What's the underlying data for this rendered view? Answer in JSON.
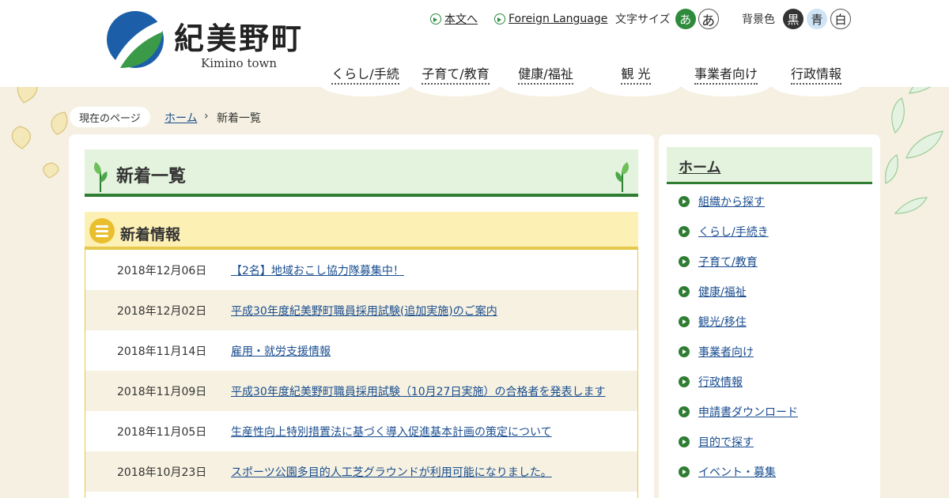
{
  "site": {
    "title": "紀美野町",
    "subtitle": "Kimino town"
  },
  "util": {
    "skip_label": "本文へ",
    "foreign_label": "Foreign Language",
    "fontsize_label": "文字サイズ",
    "fontsize_small": "あ",
    "fontsize_large": "あ",
    "bg_label": "背景色",
    "bg_black": "黒",
    "bg_blue": "青",
    "bg_white": "白"
  },
  "nav": [
    "くらし/手続",
    "子育て/教育",
    "健康/福祉",
    "観 光",
    "事業者向け",
    "行政情報"
  ],
  "breadcrumb": {
    "current_label": "現在のページ",
    "home": "ホーム",
    "separator": "›",
    "current": "新着一覧"
  },
  "page_title": "新着一覧",
  "news": {
    "heading": "新着情報",
    "items": [
      {
        "date": "2018年12月06日",
        "title": "【2名】地域おこし協力隊募集中！"
      },
      {
        "date": "2018年12月02日",
        "title": "平成30年度紀美野町職員採用試験(追加実施)のご案内"
      },
      {
        "date": "2018年11月14日",
        "title": "雇用・就労支援情報"
      },
      {
        "date": "2018年11月09日",
        "title": "平成30年度紀美野町職員採用試験（10月27日実施）の合格者を発表します"
      },
      {
        "date": "2018年11月05日",
        "title": "生産性向上特別措置法に基づく導入促進基本計画の策定について"
      },
      {
        "date": "2018年10月23日",
        "title": "スポーツ公園多目的人工芝グラウンドが利用可能になりました。"
      }
    ]
  },
  "sidebar": {
    "heading": "ホーム",
    "items": [
      "組織から探す",
      "くらし/手続き",
      "子育て/教育",
      "健康/福祉",
      "観光/移住",
      "事業者向け",
      "行政情報",
      "申請書ダウンロード",
      "目的で探す",
      "イベント・募集"
    ]
  },
  "colors": {
    "accent_green": "#2e7d32",
    "news_yellow": "#e9bf2d",
    "link_blue": "#1a4d8f"
  },
  "icons": [
    "logo-mark",
    "arrow-circle-icon",
    "list-icon",
    "sprout-icon",
    "ginkgo-leaf-icon",
    "green-leaf-icon"
  ]
}
